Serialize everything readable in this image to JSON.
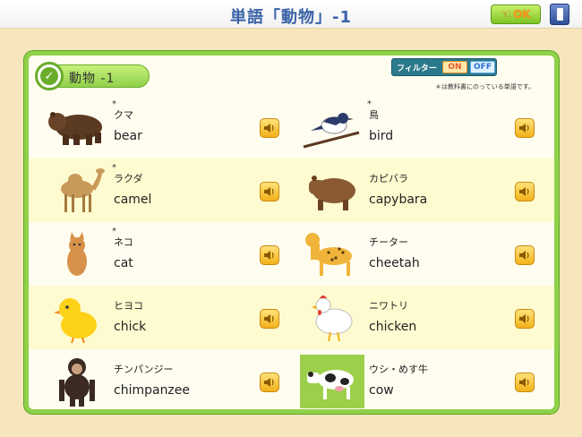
{
  "header": {
    "title": "単語「動物」-1",
    "ok_label": "OK"
  },
  "panel": {
    "category": "動物 -1",
    "filter_label": "フィルター",
    "filter_on": "ON",
    "filter_off": "OFF",
    "note": "＊は教科書にのっている単語です。"
  },
  "rows": [
    {
      "left": {
        "kana": "クマ",
        "eng": "bear",
        "star": "*"
      },
      "right": {
        "kana": "鳥",
        "eng": "bird",
        "star": "*"
      }
    },
    {
      "left": {
        "kana": "ラクダ",
        "eng": "camel",
        "star": "*"
      },
      "right": {
        "kana": "カピバラ",
        "eng": "capybara",
        "star": ""
      }
    },
    {
      "left": {
        "kana": "ネコ",
        "eng": "cat",
        "star": "*"
      },
      "right": {
        "kana": "チーター",
        "eng": "cheetah",
        "star": ""
      }
    },
    {
      "left": {
        "kana": "ヒヨコ",
        "eng": "chick",
        "star": ""
      },
      "right": {
        "kana": "ニワトリ",
        "eng": "chicken",
        "star": ""
      }
    },
    {
      "left": {
        "kana": "チンパンジー",
        "eng": "chimpanzee",
        "star": ""
      },
      "right": {
        "kana": "ウシ・めす牛",
        "eng": "cow",
        "star": ""
      }
    }
  ],
  "icons": {
    "ok": "pointing-hand-icon",
    "exit": "door-icon",
    "sound": "speaker-icon",
    "check": "check-icon"
  }
}
